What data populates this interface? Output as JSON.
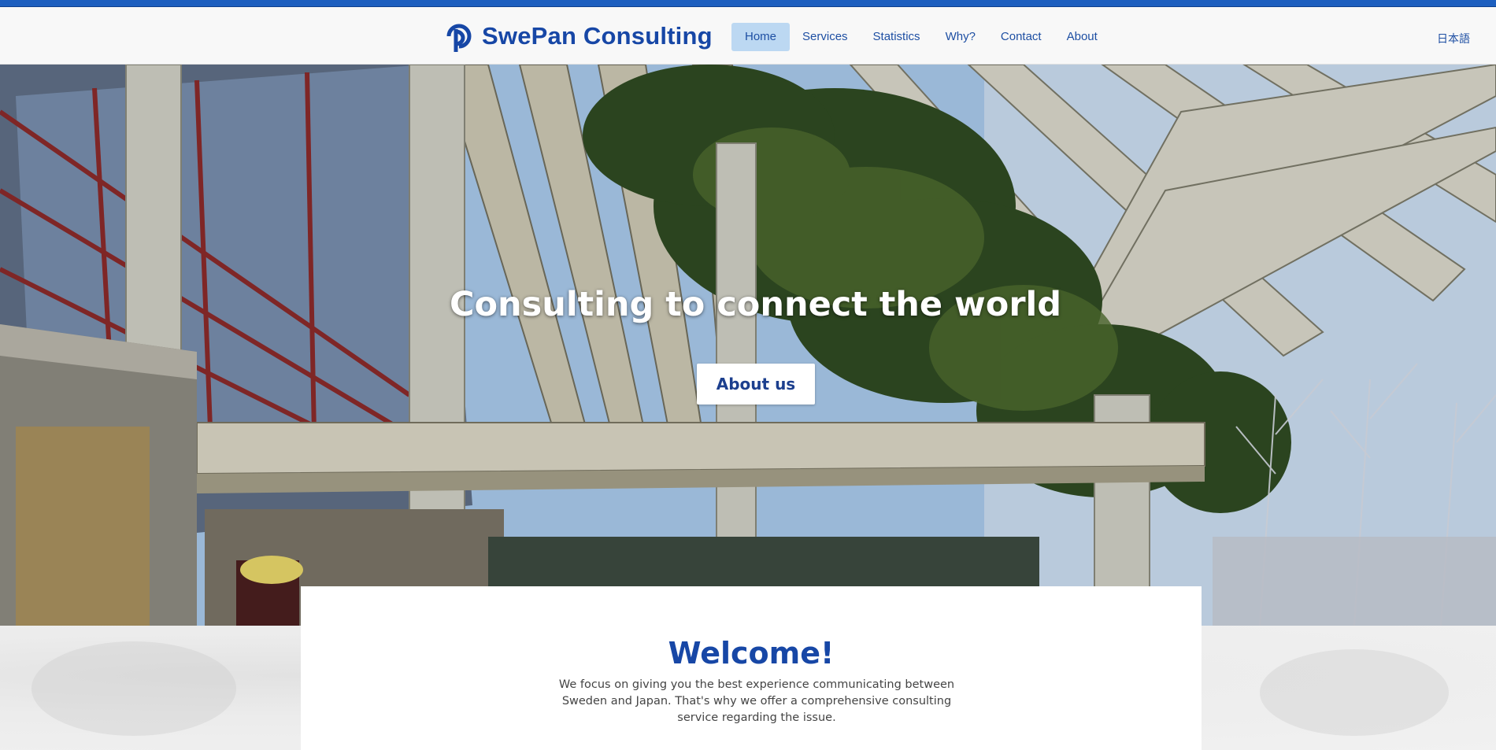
{
  "brand": {
    "name": "SwePan Consulting",
    "logo_icon": "swepan-logo-icon",
    "color": "#1747a6"
  },
  "nav": {
    "items": [
      {
        "label": "Home",
        "active": true
      },
      {
        "label": "Services",
        "active": false
      },
      {
        "label": "Statistics",
        "active": false
      },
      {
        "label": "Why?",
        "active": false
      },
      {
        "label": "Contact",
        "active": false
      },
      {
        "label": "About",
        "active": false
      }
    ],
    "language_link": "日本語"
  },
  "hero": {
    "title": "Consulting to connect the world",
    "button_label": "About us"
  },
  "welcome": {
    "title": "Welcome!",
    "text": "We focus on giving you the best experience communicating between Sweden and Japan. That's why we offer a comprehensive consulting service regarding the issue."
  },
  "colors": {
    "accent": "#1d5fbf",
    "nav_active_bg": "#bcd8f2",
    "link": "#1e4fa3"
  }
}
